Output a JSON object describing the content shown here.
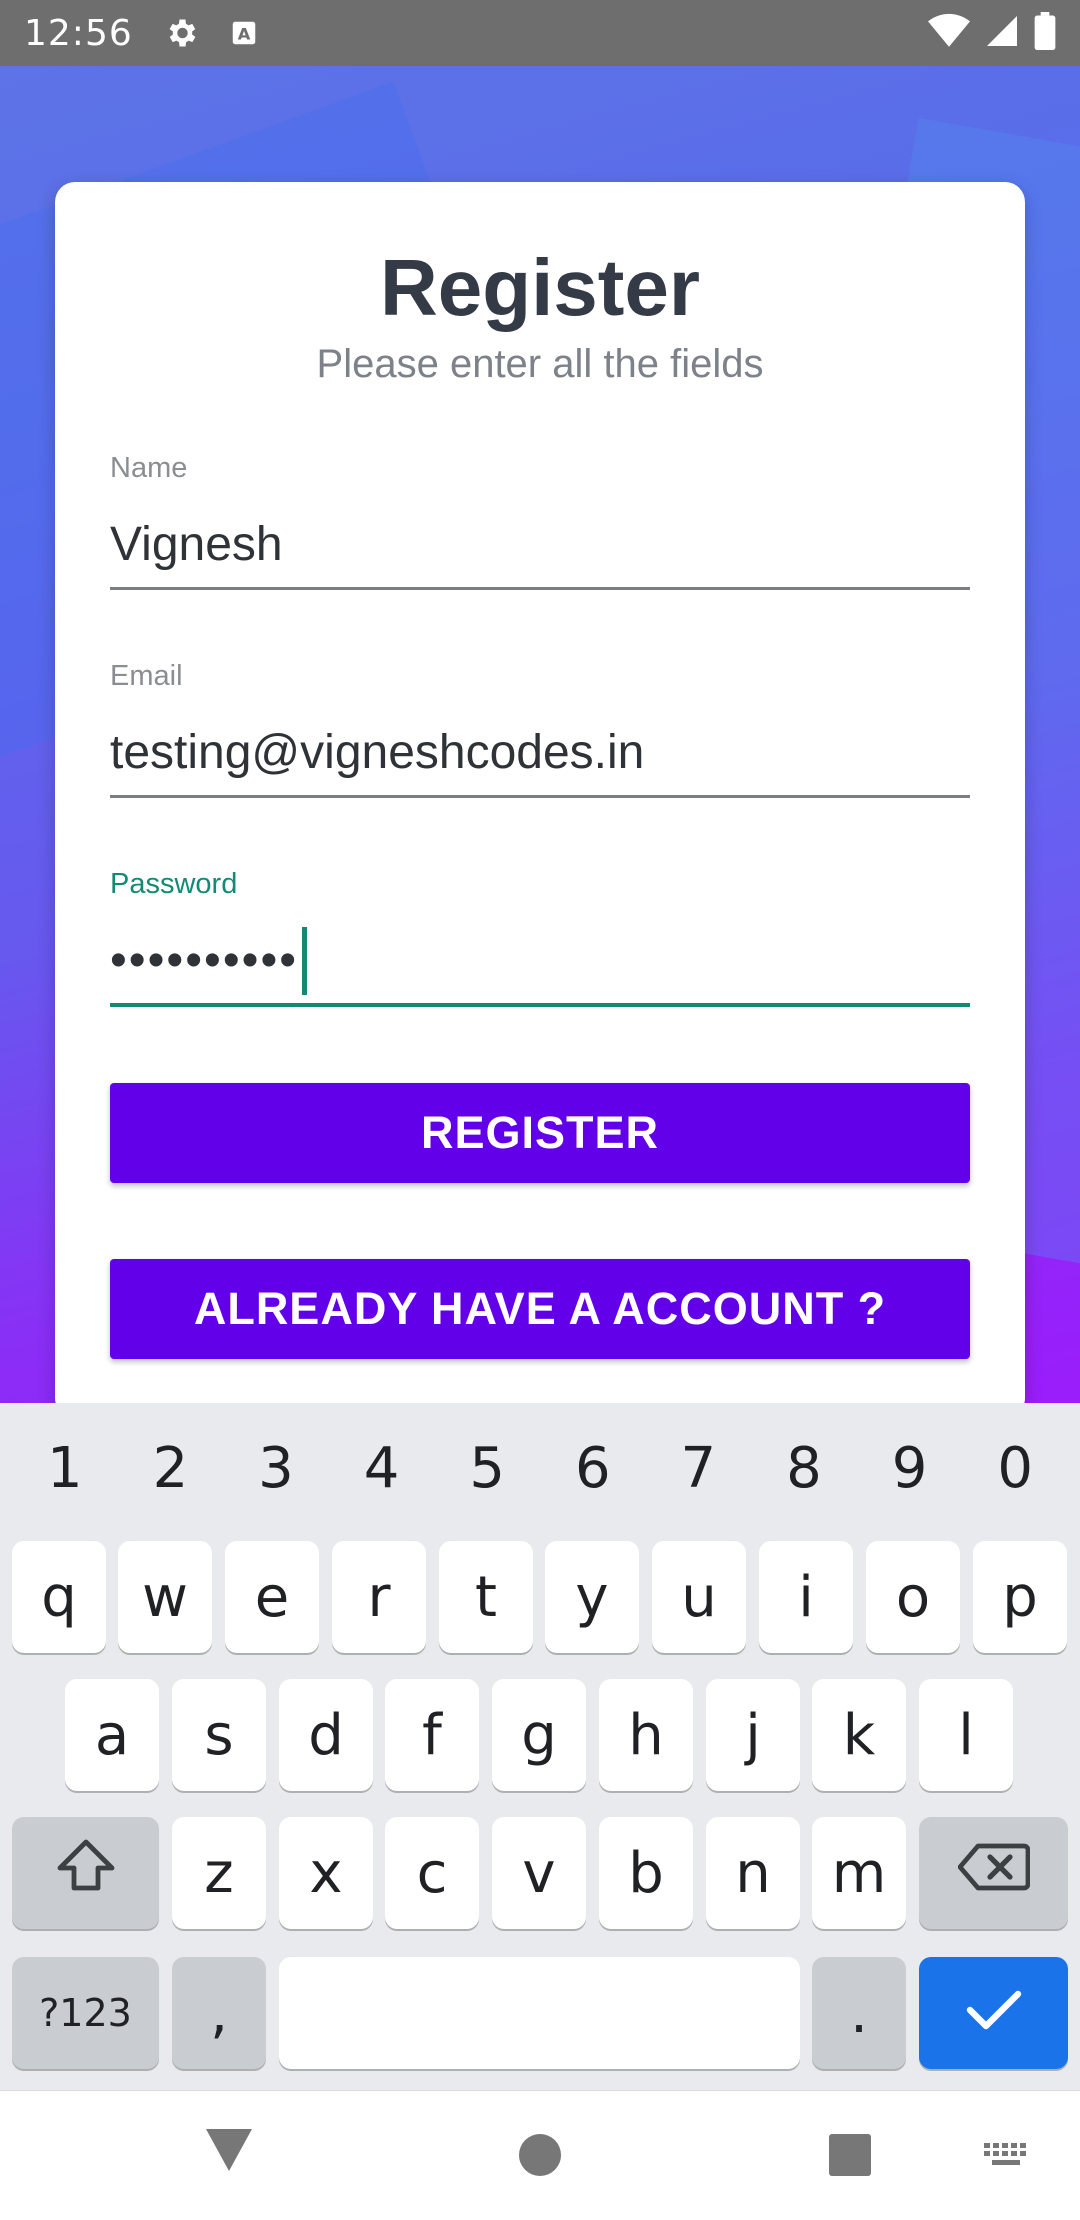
{
  "status_bar": {
    "time": "12:56",
    "icons": [
      "gear-icon",
      "keyboard-a-icon",
      "wifi-icon",
      "signal-icon",
      "battery-icon"
    ]
  },
  "form": {
    "title": "Register",
    "subtitle": "Please enter all the fields",
    "name_label": "Name",
    "name_value": "Vignesh",
    "email_label": "Email",
    "email_value": "testing@vigneshcodes.in",
    "password_label": "Password",
    "password_value": "••••••••••",
    "register_button": "REGISTER",
    "account_button": "ALREADY HAVE A ACCOUNT ?"
  },
  "keyboard": {
    "numbers": [
      "1",
      "2",
      "3",
      "4",
      "5",
      "6",
      "7",
      "8",
      "9",
      "0"
    ],
    "row1": [
      "q",
      "w",
      "e",
      "r",
      "t",
      "y",
      "u",
      "i",
      "o",
      "p"
    ],
    "row2": [
      "a",
      "s",
      "d",
      "f",
      "g",
      "h",
      "j",
      "k",
      "l"
    ],
    "row3": [
      "z",
      "x",
      "c",
      "v",
      "b",
      "n",
      "m"
    ],
    "symbols_key": "?123",
    "comma_key": ",",
    "period_key": "."
  },
  "colors": {
    "accent": "#6200ea",
    "focus": "#138a74",
    "enter_key": "#1a73e8"
  }
}
